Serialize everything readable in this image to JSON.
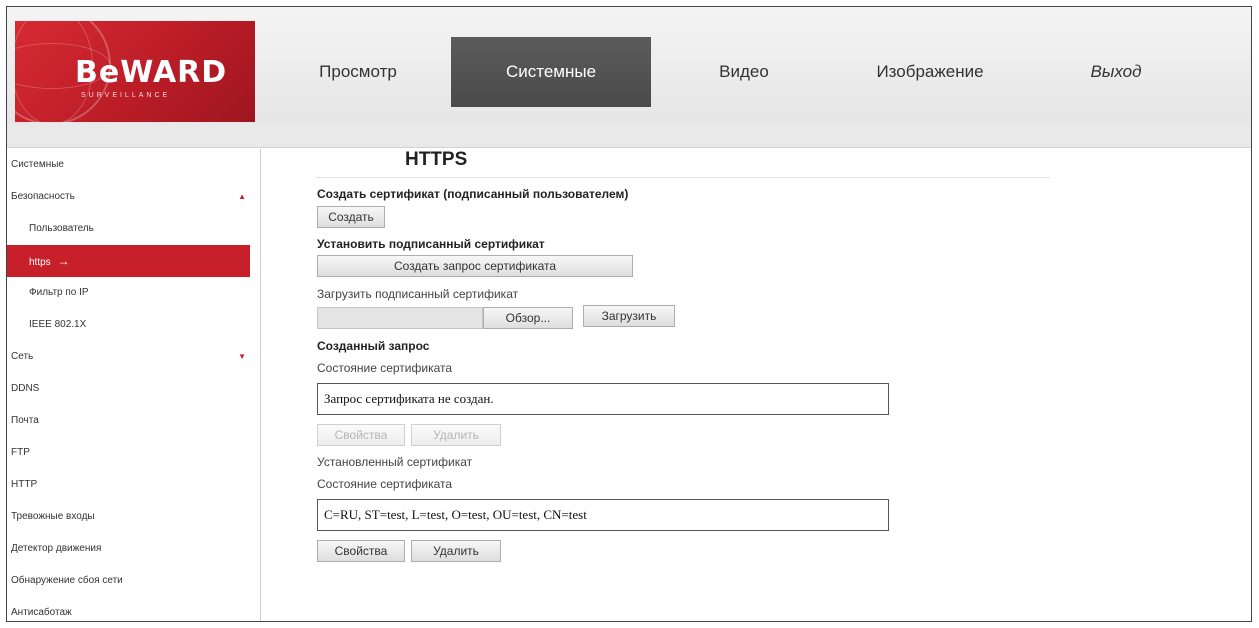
{
  "brand": {
    "logo_text": "BeWARD",
    "logo_sub": "SURVEILLANCE"
  },
  "nav": {
    "items": [
      {
        "label": "Просмотр"
      },
      {
        "label": "Системные"
      },
      {
        "label": "Видео"
      },
      {
        "label": "Изображение"
      },
      {
        "label": "Выход"
      }
    ]
  },
  "sidebar": {
    "items": [
      {
        "label": "Системные"
      },
      {
        "label": "Безопасность"
      },
      {
        "label": "Пользователь"
      },
      {
        "label": "https"
      },
      {
        "label": "Фильтр по IP"
      },
      {
        "label": "IEEE 802.1X"
      },
      {
        "label": "Сеть"
      },
      {
        "label": "DDNS"
      },
      {
        "label": "Почта"
      },
      {
        "label": "FTP"
      },
      {
        "label": "HTTP"
      },
      {
        "label": "Тревожные входы"
      },
      {
        "label": "Детектор движения"
      },
      {
        "label": "Обнаружение сбоя сети"
      },
      {
        "label": "Антисаботаж"
      }
    ],
    "active_arrow": "→",
    "up_arrow": "▲",
    "down_arrow": "▼"
  },
  "main": {
    "title": "HTTPS",
    "create_cert_label": "Создать сертификат (подписанный пользователем)",
    "create_button": "Создать",
    "install_signed_label": "Установить подписанный сертификат",
    "create_request_button": "Создать запрос сертификата",
    "upload_signed_label": "Загрузить подписанный сертификат",
    "browse_button": "Обзор...",
    "upload_button": "Загрузить",
    "created_request_label": "Созданный запрос",
    "cert_status_label_1": "Состояние сертификата",
    "request_status_value": "Запрос сертификата не создан.",
    "properties_button_disabled": "Свойства",
    "delete_button_disabled": "Удалить",
    "installed_cert_label": "Установленный сертификат",
    "cert_status_label_2": "Состояние сертификата",
    "installed_status_value": "C=RU, ST=test, L=test, O=test, OU=test, CN=test",
    "properties_button": "Свойства",
    "delete_button": "Удалить"
  },
  "colors": {
    "accent": "#c8202a",
    "nav_active": "#4f4f4f"
  }
}
